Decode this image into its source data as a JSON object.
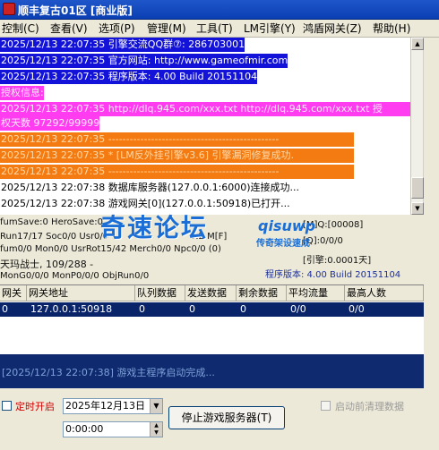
{
  "title": "顺丰复古01区 [商业版]",
  "menu": [
    "控制(C)",
    "查看(V)",
    "选项(P)",
    "管理(M)",
    "工具(T)",
    "LM引擎(Y)",
    "鸿盾网关(Z)",
    "帮助(H)"
  ],
  "log_lines": [
    "2025/12/13 22:07:35 引擎交流QQ群⑦: 286703001",
    "2025/12/13 22:07:35 官方网站: http://www.gameofmir.com",
    "2025/12/13 22:07:35 程序版本: 4.00 Build 20151104",
    "授权信息:",
    "2025/12/13 22:07:35 http://dlq.945.com/xxx.txt http://dlq.945.com/xxx.txt 授",
    "权天数 97292/99999",
    "2025/12/13 22:07:35 ------------------------------------------------",
    "2025/12/13 22:07:35 * [LM反外挂引擎v3.6] 引擎漏洞修复成功.",
    "2025/12/13 22:07:35 ------------------------------------------------",
    "2025/12/13 22:07:38 数据库服务器(127.0.0.1:6000)连接成功...",
    "2025/12/13 22:07:38 游戏网关[0](127.0.0.1:50918)已打开..."
  ],
  "status": {
    "line1": "fumSave:0 HeroSave:0",
    "line2": "Run17/17 Soc0/0 Usr0/0",
    "line3": "fum0/0 Mon0/0 UsrRot15/42 Merch0/0 Npc0/0 (0)",
    "line4": "天玛战士, 109/288 -",
    "line5": "MonG0/0/0 MonP0/0/0 ObjRun0/0",
    "right1": "[M]Q:[00008]",
    "right2": "[Q]:0/0/0",
    "right3": "[引擎:0.0001天]",
    "partial": "0.2 M[F]"
  },
  "watermark": {
    "main": "奇速论坛",
    "domain": "qisuwp",
    "sub": "传奇架设速成"
  },
  "version": "程序版本: 4.00 Build 20151104",
  "table": {
    "headers": [
      "网关",
      "网关地址",
      "队列数据",
      "发送数据",
      "剩余数据",
      "平均流量",
      "最高人数"
    ],
    "row": [
      "0",
      "127.0.0.1:50918",
      "0",
      "0",
      "0",
      "0/0",
      "0/0"
    ]
  },
  "console": "[2025/12/13 22:07:38] 游戏主程序启动完成...",
  "controls": {
    "timer_label": "定时开启",
    "date_value": "2025年12月13日",
    "time_value": "0:00:00",
    "stop_button": "停止游戏服务器(T)",
    "clear_label": "启动前清理数据"
  },
  "colors": {
    "title_bar": "#0a3fb3",
    "blue_highlight": "#1212d8",
    "magenta_highlight": "#ff3cf0",
    "orange_highlight": "#f47b12",
    "watermark": "#1a6ed6"
  }
}
